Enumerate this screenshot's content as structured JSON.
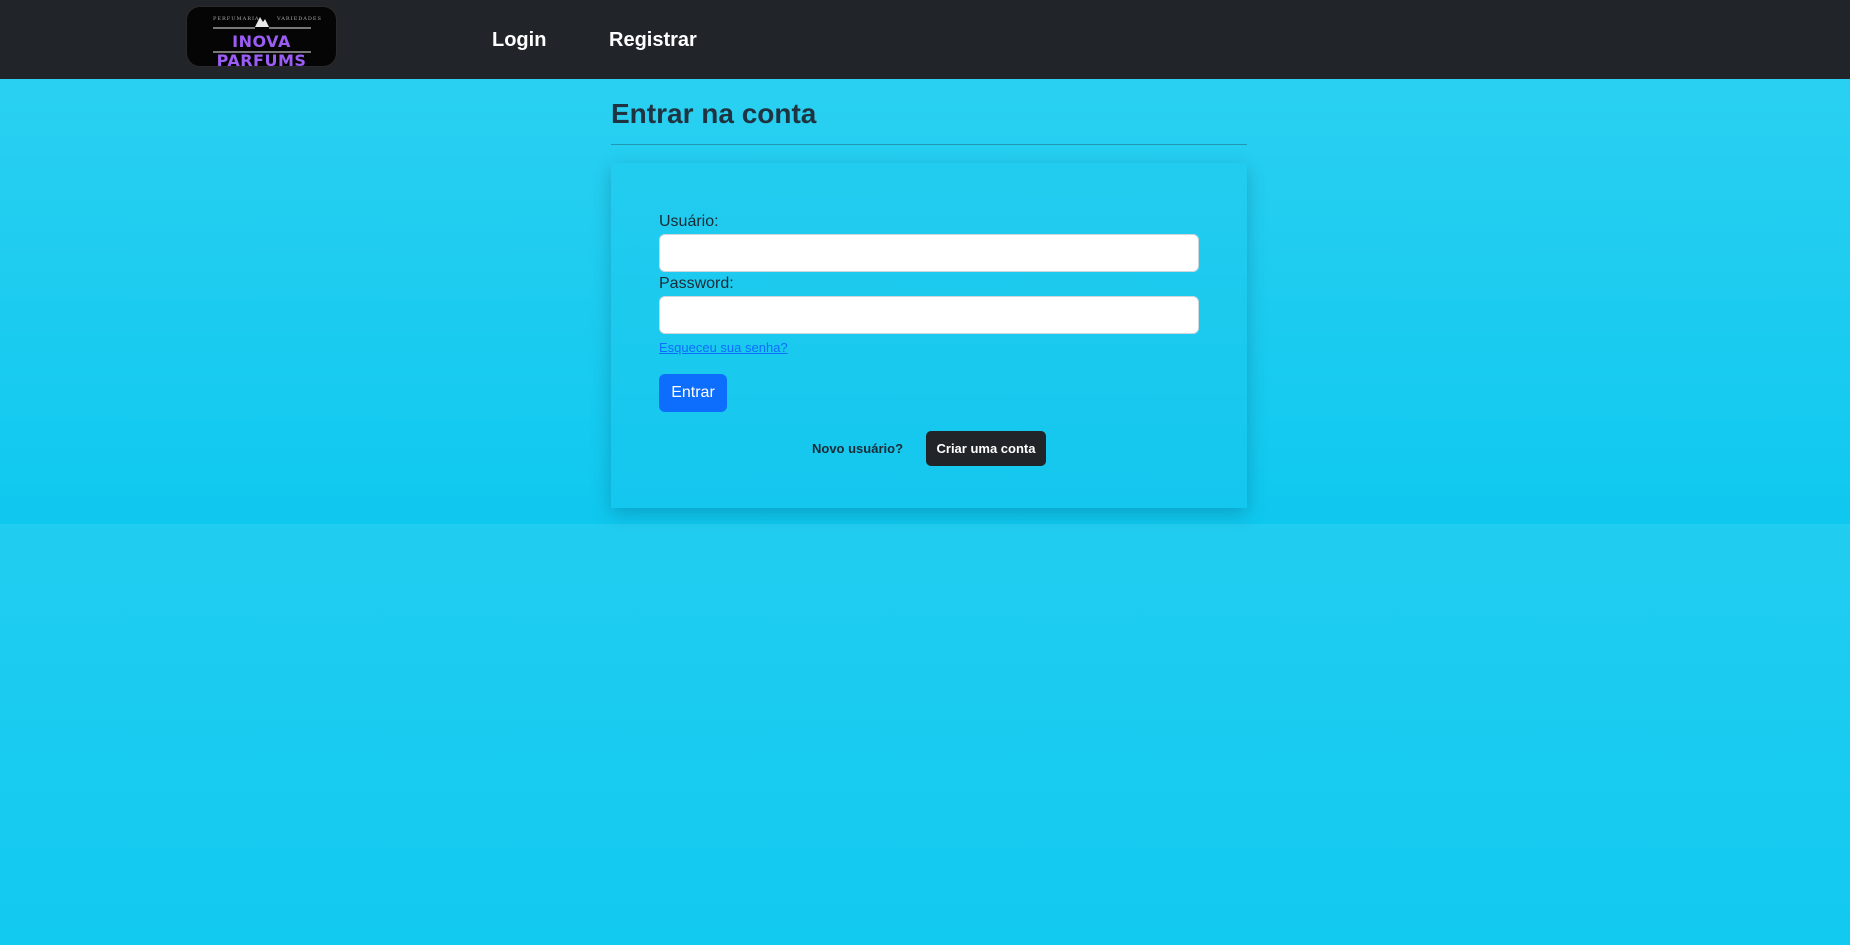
{
  "navbar": {
    "logo": {
      "top_left": "PERFUMARIA",
      "top_right": "VARIEDADES",
      "brand": "INOVA PARFUMS"
    },
    "links": [
      "Login",
      "Registrar"
    ]
  },
  "page": {
    "title": "Entrar na conta"
  },
  "form": {
    "username_label": "Usuário:",
    "username_value": "",
    "password_label": "Password:",
    "password_value": "",
    "forgot_link": "Esqueceu sua senha?",
    "submit_label": "Entrar",
    "new_user_text": "Novo usuário?",
    "create_account_label": "Criar uma conta"
  },
  "colors": {
    "navbar_bg": "#212529",
    "background": "#1ccbf0",
    "primary": "#0d6efd",
    "dark_button": "#212529",
    "logo_text": "#9b5df5"
  }
}
